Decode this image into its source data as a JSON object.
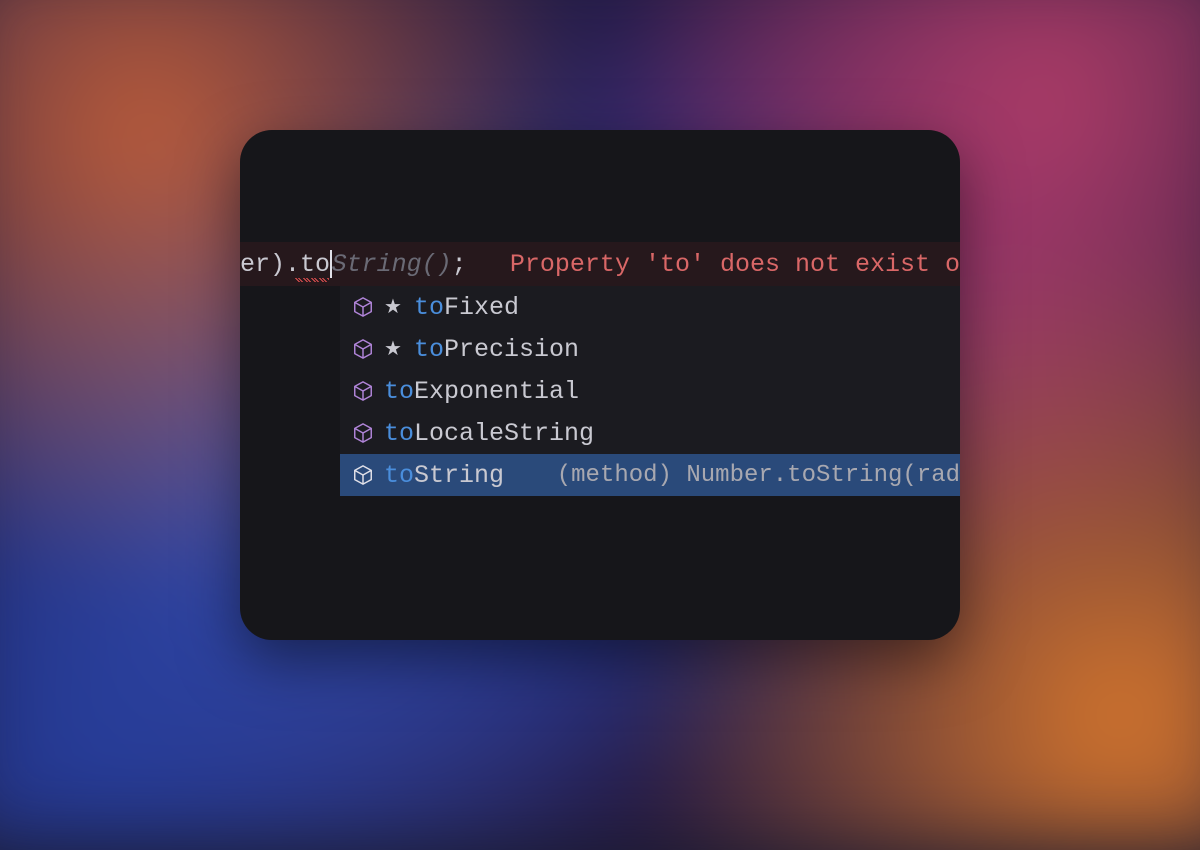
{
  "code": {
    "prefix_visible": "er)",
    "dot": ".",
    "typed": "to",
    "ghost": "String()",
    "semicolon": ";",
    "error_text": "Property 'to' does not exist o"
  },
  "suggestions": [
    {
      "match": "to",
      "rest": "Fixed",
      "starred": true,
      "selected": false,
      "detail": ""
    },
    {
      "match": "to",
      "rest": "Precision",
      "starred": true,
      "selected": false,
      "detail": ""
    },
    {
      "match": "to",
      "rest": "Exponential",
      "starred": false,
      "selected": false,
      "detail": ""
    },
    {
      "match": "to",
      "rest": "LocaleString",
      "starred": false,
      "selected": false,
      "detail": ""
    },
    {
      "match": "to",
      "rest": "String",
      "starred": false,
      "selected": true,
      "detail": "(method) Number.toString(rad"
    }
  ],
  "icons": {
    "method": "method-icon",
    "star": "★"
  },
  "colors": {
    "purple": "#b084d8",
    "white": "#e0e0e8"
  }
}
